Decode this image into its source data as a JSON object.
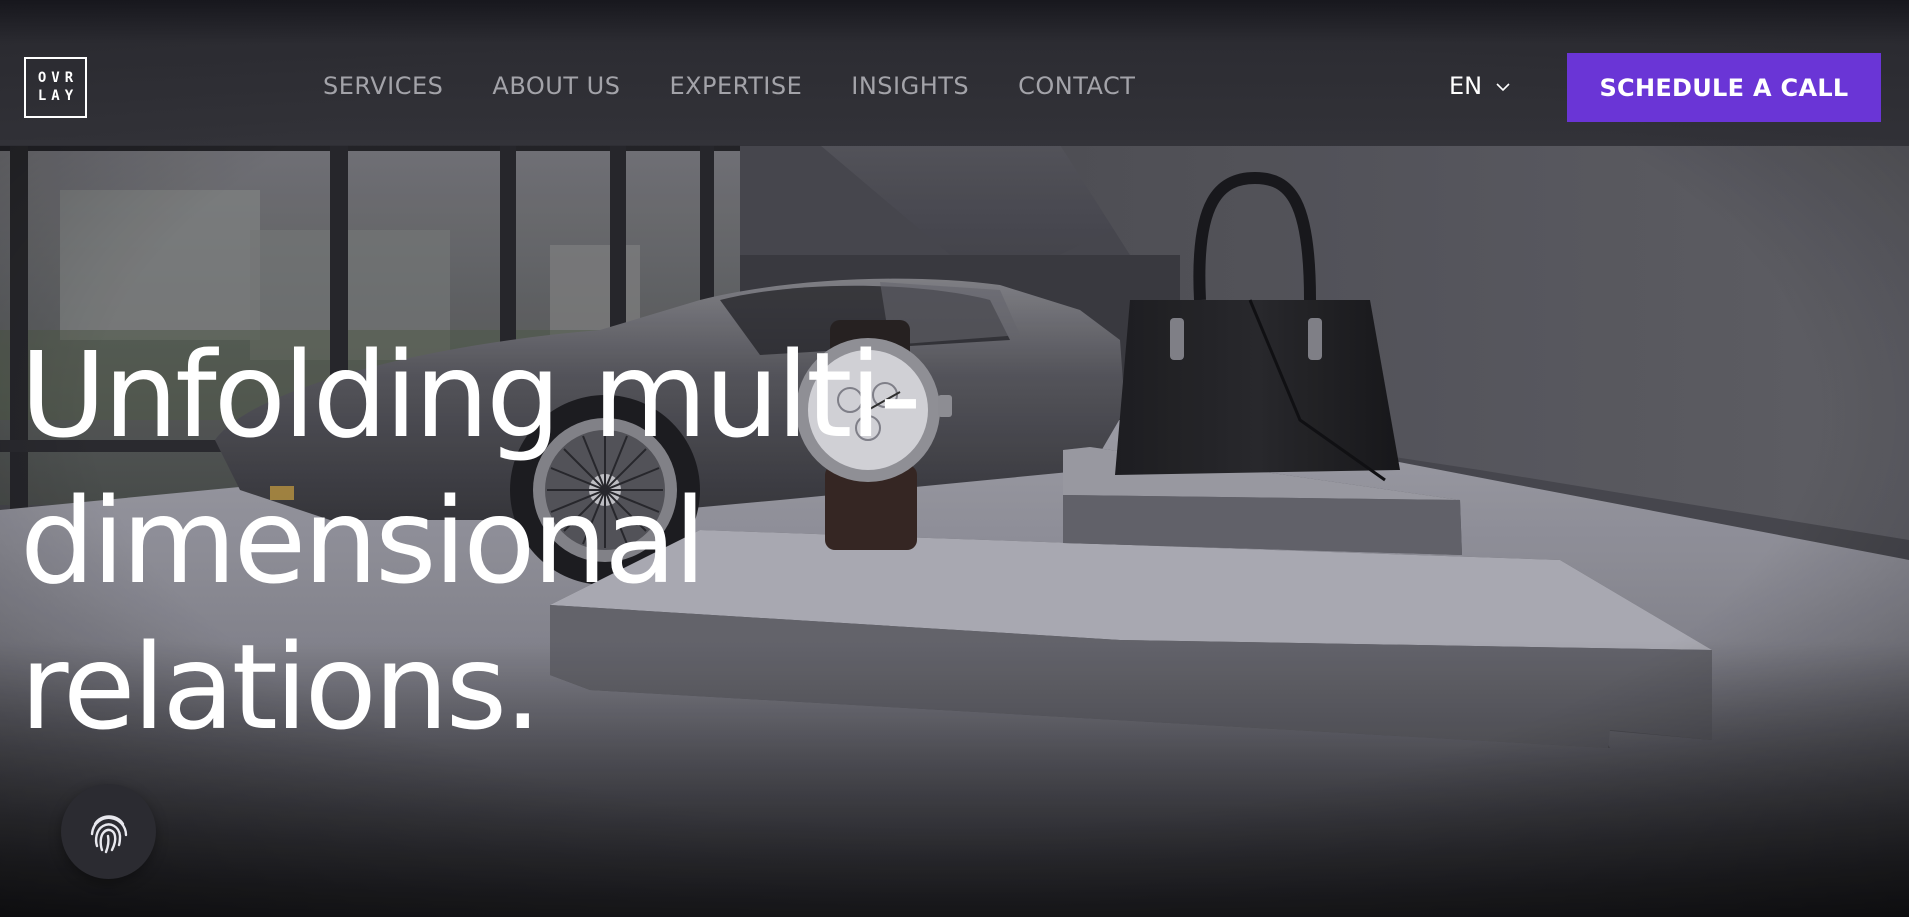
{
  "brand": {
    "logo_line1": "OVR",
    "logo_line2": "LAY"
  },
  "nav": {
    "items": [
      {
        "label": "SERVICES"
      },
      {
        "label": "ABOUT US"
      },
      {
        "label": "EXPERTISE"
      },
      {
        "label": "INSIGHTS"
      },
      {
        "label": "CONTACT"
      }
    ]
  },
  "language": {
    "selected": "EN",
    "icon": "chevron-down-icon"
  },
  "cta": {
    "label": "SCHEDULE A CALL",
    "color": "#6a35d6"
  },
  "hero": {
    "headline_lines": [
      "Unfolding multi-",
      "dimensional",
      "relations."
    ]
  },
  "widgets": {
    "fingerprint_icon": "fingerprint-icon"
  },
  "colors": {
    "accent": "#6a35d6",
    "nav_text": "#a3a3a9",
    "header_bg": "#2e2e34"
  }
}
